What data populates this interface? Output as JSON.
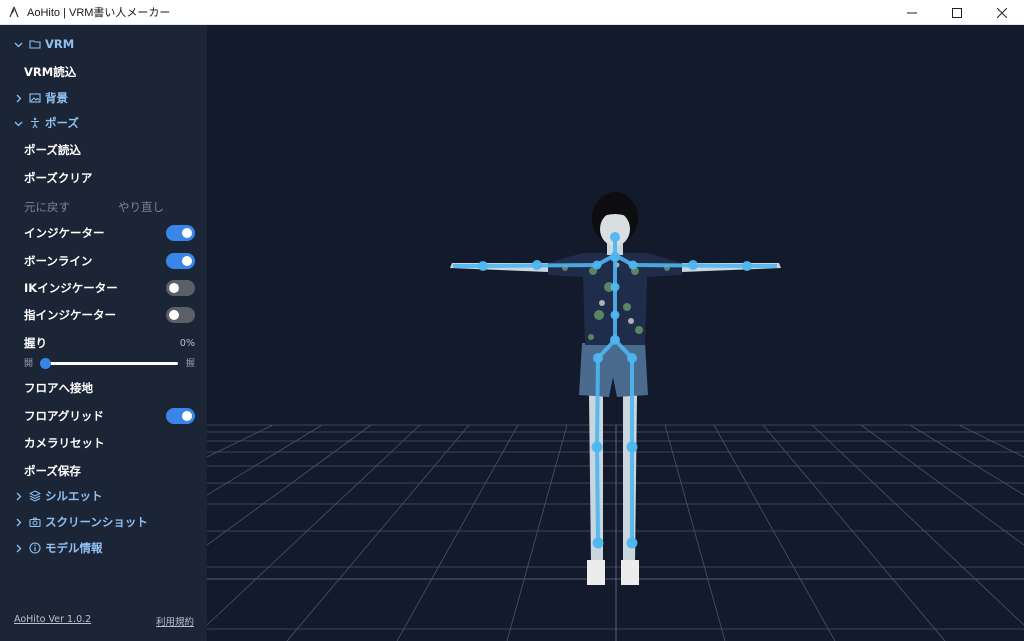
{
  "window": {
    "title": "AoHito | VRM書い人メーカー"
  },
  "sidebar": {
    "sections": {
      "vrm": {
        "label": "VRM",
        "icon": "folder-icon",
        "expanded": true
      },
      "background": {
        "label": "背景",
        "icon": "image-icon",
        "expanded": false
      },
      "pose": {
        "label": "ポーズ",
        "icon": "person-icon",
        "expanded": true
      },
      "silhouette": {
        "label": "シルエット",
        "icon": "layers-icon",
        "expanded": false
      },
      "screenshot": {
        "label": "スクリーンショット",
        "icon": "camera-icon",
        "expanded": false
      },
      "model_info": {
        "label": "モデル情報",
        "icon": "info-icon",
        "expanded": false
      }
    },
    "vrm_load": "VRM読込",
    "pose_load": "ポーズ読込",
    "pose_clear": "ポーズクリア",
    "undo": "元に戻す",
    "redo": "やり直し",
    "toggles": {
      "indicator": {
        "label": "インジケーター",
        "on": true
      },
      "bone_line": {
        "label": "ボーンライン",
        "on": true
      },
      "ik_indicator": {
        "label": "IKインジケーター",
        "on": false
      },
      "finger_indicator": {
        "label": "指インジケーター",
        "on": false
      },
      "floor_grid": {
        "label": "フロアグリッド",
        "on": true
      }
    },
    "grip": {
      "label": "握り",
      "value_text": "0%",
      "min_label": "開",
      "max_label": "握",
      "value": 0
    },
    "floor_snap": "フロアへ接地",
    "camera_reset": "カメラリセット",
    "pose_save": "ポーズ保存",
    "footer": {
      "version": "AoHito Ver 1.0.2",
      "terms": "利用規約"
    }
  },
  "colors": {
    "sidebar_bg": "#1c2536",
    "viewport_bg": "#121a2b",
    "accent": "#3a86e8",
    "section_label": "#8ec1f3",
    "bone": "#4fb6f0"
  }
}
